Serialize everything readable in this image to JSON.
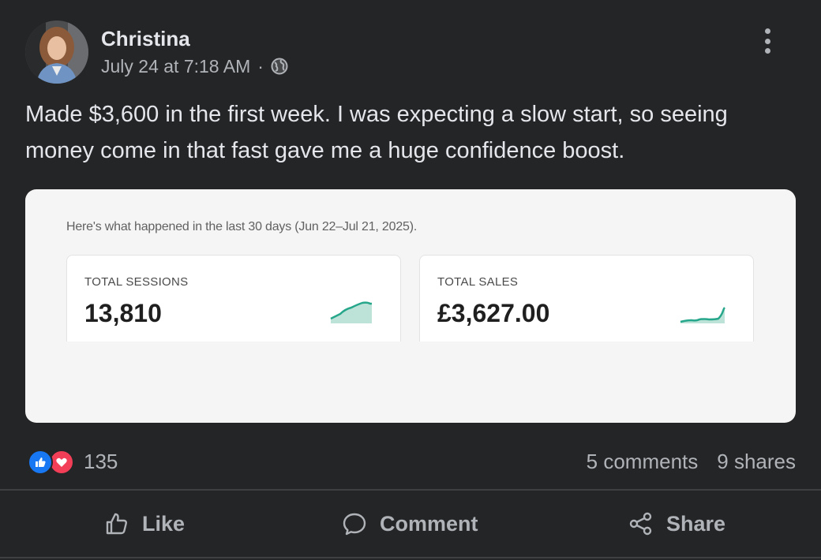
{
  "post": {
    "author": "Christina",
    "timestamp": "July 24 at 7:18 AM",
    "separator": "·",
    "privacy_icon": "globe-icon",
    "text": "Made $3,600 in the first week. I was expecting a slow start, so seeing money come in that fast gave me a huge confidence boost."
  },
  "screenshot": {
    "caption": "Here's what happened in the last 30 days (Jun 22–Jul 21, 2025).",
    "metrics": [
      {
        "label": "TOTAL SESSIONS",
        "value": "13,810",
        "sparkline": "rising-area"
      },
      {
        "label": "TOTAL SALES",
        "value": "£3,627.00",
        "sparkline": "late-spike-area"
      }
    ],
    "accent": "#26a68a"
  },
  "stats": {
    "reaction_icons": [
      "like-icon",
      "love-icon"
    ],
    "reaction_count": "135",
    "comments": "5 comments",
    "shares": "9 shares"
  },
  "actions": {
    "like": "Like",
    "comment": "Comment",
    "share": "Share"
  },
  "colors": {
    "background": "#242526",
    "text": "#e4e6eb",
    "muted": "#b0b3b8",
    "like_blue": "#1877f2",
    "love_red": "#f33e58"
  }
}
